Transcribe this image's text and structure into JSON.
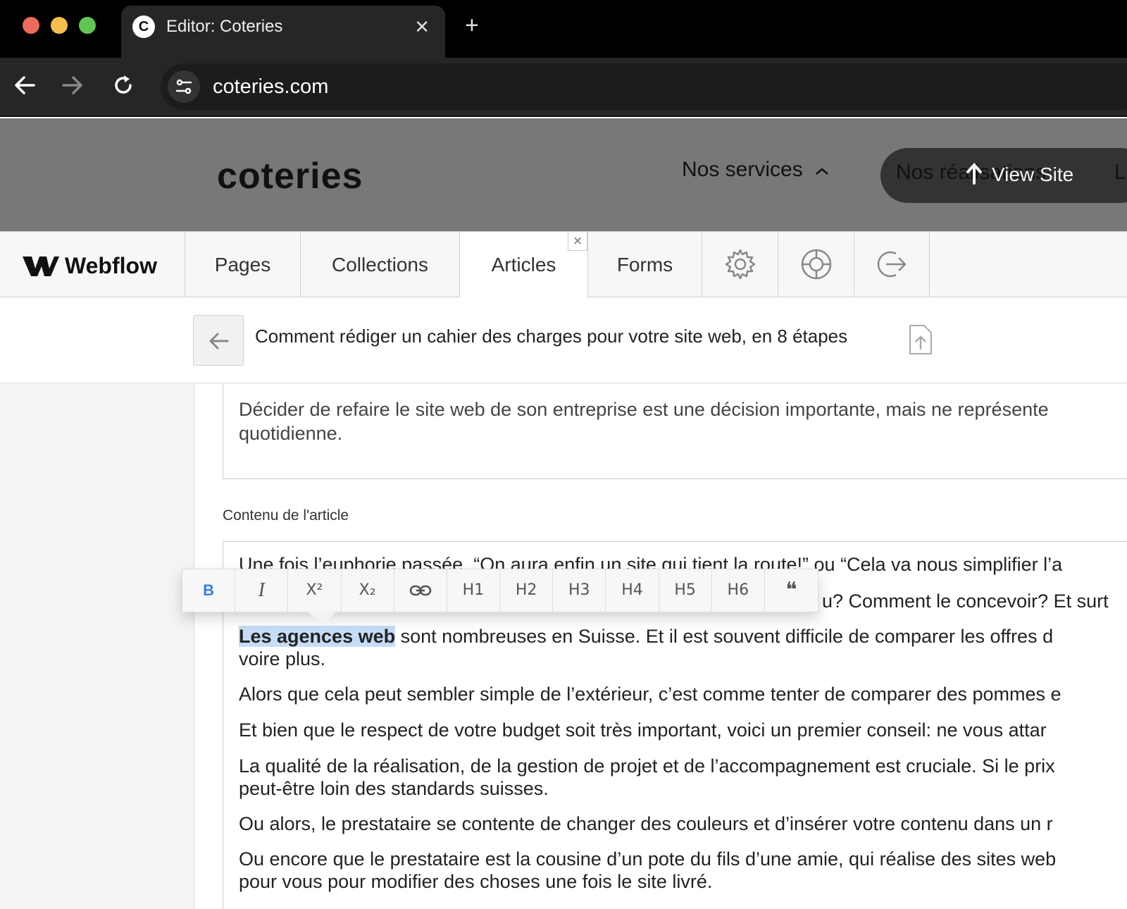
{
  "browser": {
    "tab_title": "Editor: Coteries",
    "tab_favicon": "C",
    "tab_close": "✕",
    "new_tab": "+",
    "url": "coteries.com",
    "colors": {
      "close": "#ed6a5e",
      "minimize": "#f5bf4f",
      "zoom": "#61c554"
    }
  },
  "site": {
    "logo": "coteries",
    "nav_services": "Nos services",
    "nav_realisations": "Nos réalisations",
    "nav_next": "L'",
    "view_site": "View Site"
  },
  "webflow": {
    "brand": "Webflow",
    "tabs": [
      "Pages",
      "Collections",
      "Articles",
      "Forms"
    ],
    "active_tab": "Articles",
    "icons": [
      "gear-icon",
      "lifebuoy-icon",
      "logout-icon"
    ]
  },
  "item": {
    "title": "Comment rédiger un cahier des charges pour votre site web, en 8 étapes"
  },
  "editor": {
    "summary": "Décider de refaire le site web de son entreprise est une décision importante, mais ne représente quotidienne.",
    "summary_line1": "Décider de refaire le site web de son entreprise est une décision importante, mais ne représente",
    "summary_line2": "quotidienne.",
    "content_label": "Contenu de l'article",
    "para1": "Une fois l’euphorie passée, “On aura enfin un site qui tient la route!” ou “Cela va nous simplifier l’a",
    "para2_tail": "u? Comment le concevoir? Et surt",
    "para3_selected": "Les agences web",
    "para3_rest": " sont nombreuses en Suisse. Et il est souvent difficile de comparer les offres d",
    "para3_line2": "voire plus.",
    "para4": "Alors que cela peut sembler simple de l’extérieur, c’est comme tenter de comparer des pommes e",
    "para5": "Et bien que le respect de votre budget soit très important, voici un premier conseil: ne vous attar",
    "para6_line1": "La qualité de la réalisation, de la gestion de projet et de l’accompagnement est cruciale. Si le prix",
    "para6_line2": "peut-être loin des standards suisses.",
    "para7": "Ou alors, le prestataire se contente de changer des couleurs et d’insérer votre contenu dans un r",
    "para8_line1": "Ou encore que le prestataire est la cousine d’un pote du fils d’une amie, qui réalise des sites web",
    "para8_line2": "pour vous pour modifier des choses une fois le site livré."
  },
  "format_toolbar": {
    "buttons": [
      "B",
      "I",
      "X²",
      "X₂",
      "link",
      "H1",
      "H2",
      "H3",
      "H4",
      "H5",
      "H6",
      "❝"
    ],
    "active": "B",
    "accent": "#3b7ddd"
  }
}
